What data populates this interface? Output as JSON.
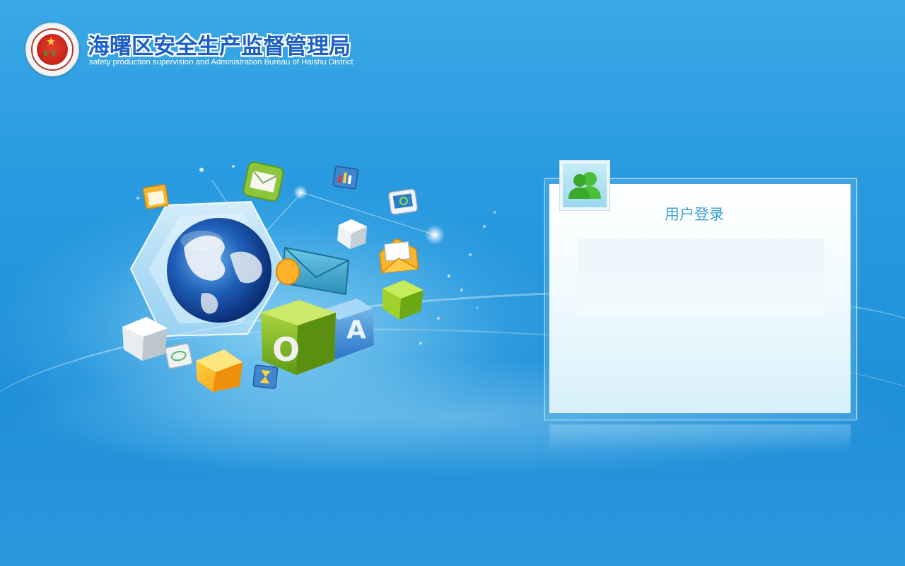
{
  "header": {
    "title": "海曙区安全生产监督管理局",
    "subtitle": "safety production supervision and Administration Bureau of Haishu District",
    "emblem_icon": "government-emblem-icon"
  },
  "login": {
    "title": "用户登录",
    "avatar_icon": "users-icon"
  },
  "illustration": {
    "badge_letters": [
      "O",
      "A"
    ],
    "icons": [
      "globe-icon",
      "mail-icon",
      "envelope-icon",
      "cube-icon",
      "calendar-icon",
      "hourglass-icon",
      "search-icon",
      "chart-icon"
    ]
  },
  "colors": {
    "background": "#2a9be0",
    "title_blue": "#1a5fc6",
    "login_title": "#3fa0d6",
    "avatar_green": "#4cbf3a"
  }
}
